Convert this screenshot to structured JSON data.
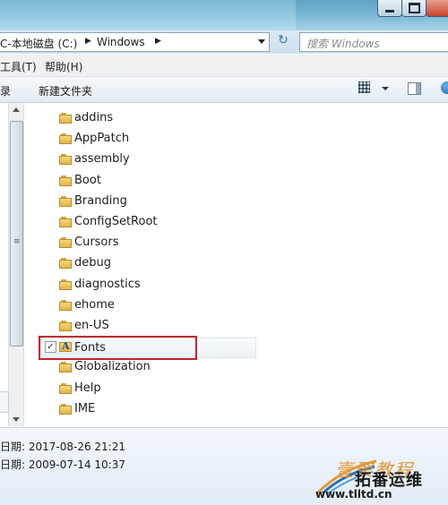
{
  "window": {
    "min_icon": "minimize-icon",
    "max_icon": "maximize-icon",
    "close_icon": "close-icon"
  },
  "address": {
    "crumbs": [
      "C-本地磁盘 (C:)",
      "Windows"
    ],
    "search_placeholder": "搜索 Windows"
  },
  "menu": {
    "tools": "工具(T)",
    "help": "帮助(H)"
  },
  "toolbar": {
    "left_fragment": "录",
    "new_folder": "新建文件夹"
  },
  "tree": {
    "folders": [
      "addins",
      "AppPatch",
      "assembly",
      "Boot",
      "Branding",
      "ConfigSetRoot",
      "Cursors",
      "debug",
      "diagnostics",
      "ehome",
      "en-US",
      "Fonts",
      "Globalization",
      "Help",
      "IME"
    ],
    "selected": "Fonts",
    "checked": "✓",
    "highlight_color": "#c1272d"
  },
  "details": {
    "modified": "日期: 2017-08-26 21:21",
    "created": "日期: 2009-07-14 10:37"
  },
  "watermark": {
    "line1": "壹聚教程",
    "line2": "拓番运维",
    "url": "www.tlltd.cn"
  }
}
